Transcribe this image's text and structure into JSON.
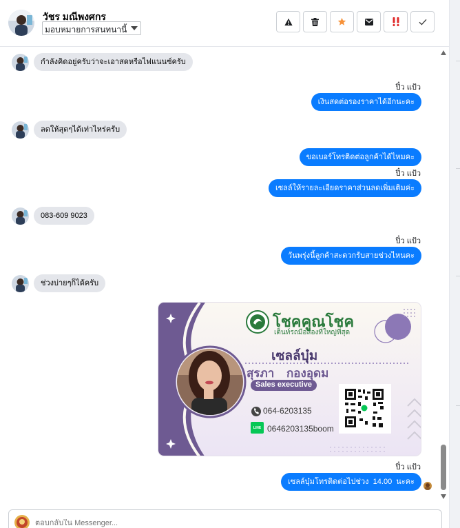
{
  "header": {
    "contact_name": "วัชร มณีพงศกร",
    "assign_label": "มอบหมายการสนทนานี้",
    "toolbar": [
      {
        "icon": "warning-icon",
        "color": "#1c1e21"
      },
      {
        "icon": "trash-icon",
        "color": "#1c1e21"
      },
      {
        "icon": "star-icon",
        "color": "#f7923a"
      },
      {
        "icon": "mail-icon",
        "color": "#1c1e21"
      },
      {
        "icon": "spam-icon",
        "color": "#e02a2a"
      },
      {
        "icon": "check-icon",
        "color": "#1c1e21"
      }
    ]
  },
  "thread": {
    "messages": [
      {
        "dir": "in",
        "text": "กำลังคิดอยู่ครับว่าจะเอาสดหรือไฟแนนซ์ครับ"
      },
      {
        "dir": "out",
        "sender": "ปิ๋ว แป้ว",
        "text": "เงินสดต่อรองราคาได้อีกนะคะ"
      },
      {
        "dir": "in",
        "text": "ลดให้สุดๆได้เท่าไหร่ครับ"
      },
      {
        "dir": "out",
        "text": "ขอเบอร์โทรติดต่อลูกค้าได้ไหมคะ"
      },
      {
        "dir": "out",
        "sender": "ปิ๋ว แป้ว",
        "text": "เซลล์ให้รายละเอียดราคาส่วนลดเพิ่มเติมค่ะ"
      },
      {
        "dir": "in",
        "text": "083-609 9023"
      },
      {
        "dir": "out",
        "sender": "ปิ๋ว แป้ว",
        "text": "วันพรุ่งนี้ลูกค้าสะดวกรับสายช่วงไหนคะ"
      },
      {
        "dir": "in",
        "text": "ช่วงบ่ายๆก็ได้ครับ"
      },
      {
        "dir": "out",
        "sender": "ปิ๋ว แป้ว",
        "text": "เซลล์บุ๋มโทรติดต่อไปช่วง  14.00  นะคะ"
      }
    ],
    "business_card": {
      "brand_title": "โชคคูณโชค",
      "brand_tagline": "เต็นท์รถมือสองที่ใหญ่ที่สุด",
      "nickname": "เซลล์บุ๋ม",
      "full_name": "สุรภา   กองอุดม",
      "position": "Sales executive",
      "phone": "064-6203135",
      "line_id": "0646203135boom",
      "line_badge": "LINE"
    }
  },
  "reply": {
    "placeholder": "ตอบกลับใน Messenger..."
  },
  "colors": {
    "outgoing_bubble": "#0a7cff",
    "incoming_bubble": "#e4e6eb",
    "card_purple": "#6e5a92"
  }
}
